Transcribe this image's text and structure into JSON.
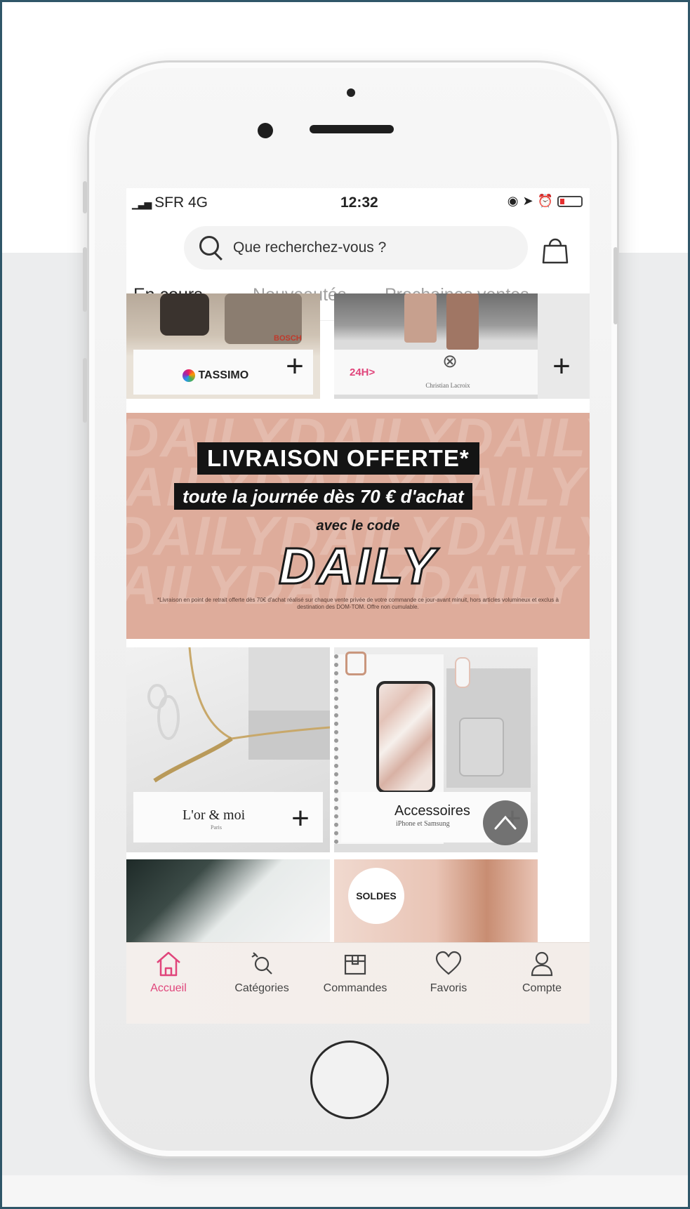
{
  "status_bar": {
    "carrier": "SFR 4G",
    "time": "12:32"
  },
  "search": {
    "placeholder": "Que recherchez-vous ?"
  },
  "tabs": [
    {
      "label": "En cours",
      "active": true
    },
    {
      "label": "Nouveautés",
      "active": false
    },
    {
      "label": "Prochaines ventes",
      "active": false
    }
  ],
  "top_cards": [
    {
      "brand": "TASSIMO",
      "image_text": "BOSCH"
    },
    {
      "badge": "24H>",
      "brand": "Christian Lacroix"
    }
  ],
  "promo": {
    "line1": "LIVRAISON OFFERTE*",
    "line2": "toute la journée dès 70 € d'achat",
    "line3": "avec le code",
    "code": "DAILY",
    "background_word": "DAILY",
    "fine_print": "*Livraison en point de retrait offerte dès 70€ d'achat réalisé sur chaque vente privée de votre commande ce jour-avant minuit, hors articles volumineux et exclus à destination des DOM-TOM. Offre non cumulable.",
    "colors": {
      "background": "#deac9b"
    }
  },
  "mid_cards": [
    {
      "brand": "L'or & moi",
      "subtitle": "Paris"
    },
    {
      "brand": "Accessoires",
      "subtitle": "iPhone et Samsung"
    }
  ],
  "bottom_card_partial": {
    "text": "SOLDES"
  },
  "tab_bar": [
    {
      "label": "Accueil",
      "icon": "home-icon",
      "active": true
    },
    {
      "label": "Catégories",
      "icon": "categories-search-icon",
      "active": false
    },
    {
      "label": "Commandes",
      "icon": "package-icon",
      "active": false
    },
    {
      "label": "Favoris",
      "icon": "heart-icon",
      "active": false
    },
    {
      "label": "Compte",
      "icon": "user-icon",
      "active": false
    }
  ],
  "accent_color": "#e0457b"
}
